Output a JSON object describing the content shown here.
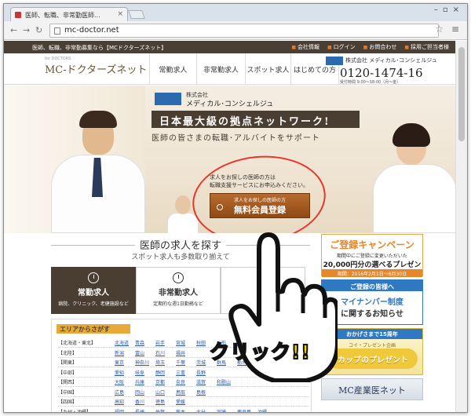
{
  "browser": {
    "tab_title": "医師、転職、非常勤医師...",
    "url": "mc-doctor.net"
  },
  "site": {
    "tagline": "医師、転職、非常勤募集なら【MCドクターズネット】",
    "top_links": [
      "会社情報",
      "ログイン",
      "お問合わせ",
      "採用ご担当者様"
    ],
    "logo": "MC-ドクターズネット",
    "logo_sub": "for DOCTORS",
    "nav": [
      "常勤求人",
      "非常勤求人",
      "スポット求人",
      "はじめての方"
    ],
    "corp_name": "株式会社 メディカル･コンシェルジュ",
    "phone": "0120-1474-16",
    "hours": "受付時間 9:00～18:00（月～金）"
  },
  "hero": {
    "corp_small": "株式会社",
    "corp_name": "メディカル･コンシェルジュ",
    "headline": "日本最大級の拠点ネットワーク!",
    "subline": "医師の皆さまの転職･アルバイトをサポート",
    "cta_text_1": "求人をお探しの医師の方は",
    "cta_text_2": "転職支援サービスにお申込みください。",
    "cta_small": "求人をお探しの医師の方",
    "cta_label": "無料会員登録"
  },
  "search": {
    "title": "医師の求人を探す",
    "subtitle": "スポット求人も多数取り揃えて",
    "tabs": [
      {
        "title": "常勤求人",
        "desc": "病院、クリニック、老健施設など"
      },
      {
        "title": "非常勤求人",
        "desc": "定期的な週1日勤務など"
      },
      {
        "title": "ス",
        "desc": ""
      }
    ],
    "area_head": "エリアからさがす",
    "areas": [
      {
        "region": "【北海道・東北】",
        "prefs": [
          "北海道",
          "青森",
          "岩手",
          "宮城",
          "秋田",
          "山形",
          "福島"
        ]
      },
      {
        "region": "【北陸】",
        "prefs": [
          "新潟",
          "富山",
          "石川",
          "福井"
        ]
      },
      {
        "region": "【関東】",
        "prefs": [
          "東京",
          "神奈川",
          "埼玉",
          "千葉",
          "茨城",
          "群馬",
          "栃木"
        ]
      },
      {
        "region": "【中部】",
        "prefs": [
          "愛知",
          "岐阜",
          "静岡",
          "三重",
          "長野"
        ]
      },
      {
        "region": "【関西】",
        "prefs": [
          "大阪",
          "兵庫",
          "京都",
          "奈良",
          "滋賀",
          "和歌山"
        ]
      },
      {
        "region": "【中国】",
        "prefs": [
          "広島",
          "岡山",
          "山口",
          "鳥取",
          "島根"
        ]
      },
      {
        "region": "【四国】",
        "prefs": [
          "高知",
          "香川",
          "徳島",
          "愛媛"
        ]
      },
      {
        "region": "【九州・沖縄】",
        "prefs": [
          "福岡",
          "長崎",
          "佐賀",
          "熊本",
          "大分",
          "宮崎",
          "鹿児島",
          "沖縄"
        ]
      }
    ]
  },
  "sidebar": {
    "register_campaign": {
      "title": "ご登録キャンペーン",
      "line1": "期間中にご登録に変更いただいた",
      "line2": "20,000円分の選べるプレゼント!",
      "period": "期間：2016年2月1日～6月30日"
    },
    "mynumber": {
      "head": "ご登録の皆様へ",
      "line1": "マイナンバー制度",
      "line2": "に関するお知らせ"
    },
    "anniversary": {
      "head": "おかげさまで15周年",
      "line1": "コイ・プレゼント企画",
      "button": "カップのプレゼント"
    },
    "industrial": "MC産業医ネット"
  },
  "overlay": {
    "click_text": "クリック!!"
  },
  "colors": {
    "brand_brown": "#4a3e33",
    "cta_orange": "#b86a2c",
    "annotation_red": "#e8362b",
    "click_yellow": "#f5d90e"
  }
}
